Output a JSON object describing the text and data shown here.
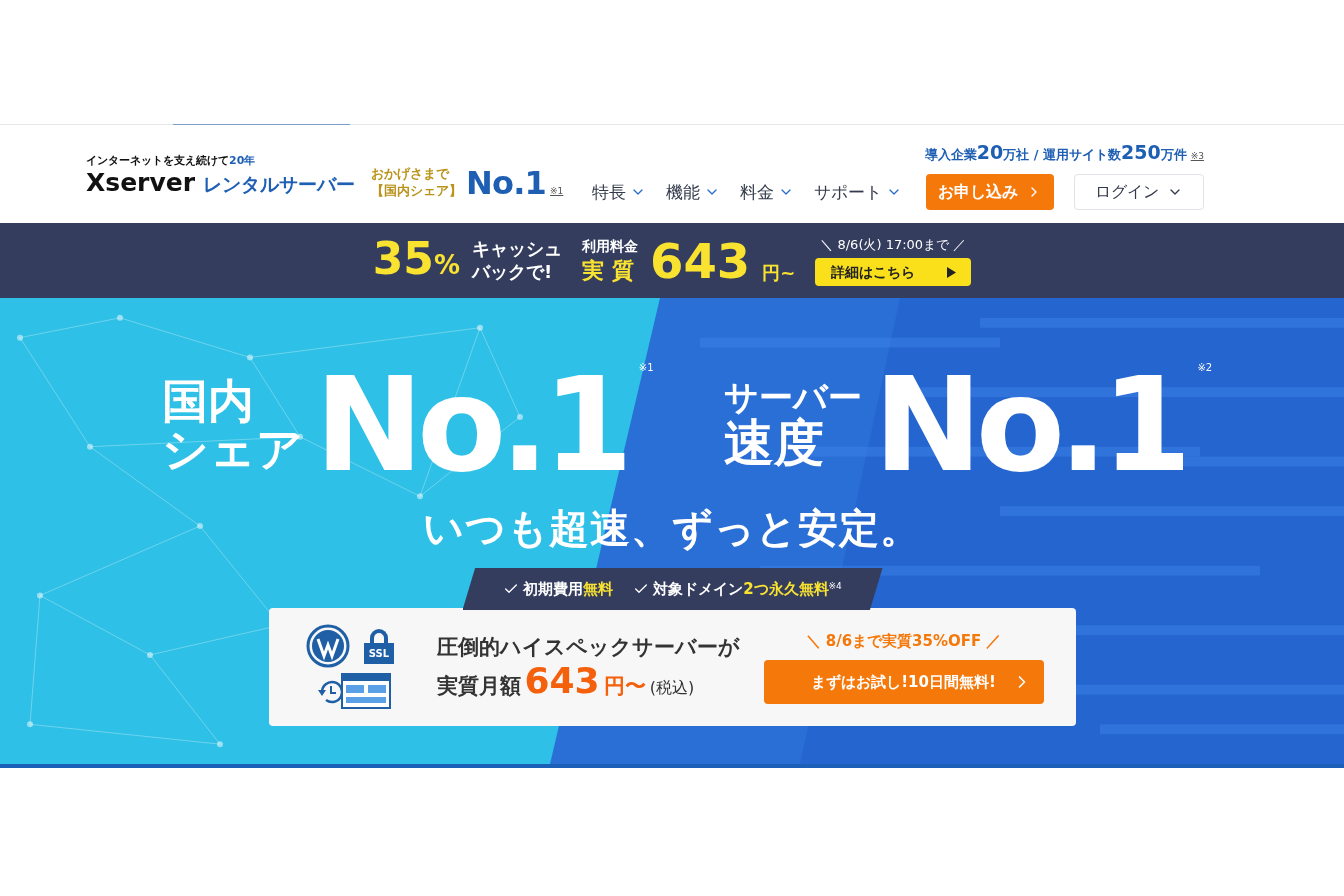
{
  "header": {
    "tagline": "インターネットを支え続けて",
    "tagline_years": "20年",
    "logo_word": "Xserver",
    "logo_sub": "レンタルサーバー",
    "award_line1": "おかげさまで",
    "award_line2": "【国内シェア】",
    "award_no": "No.1",
    "award_note": "※1",
    "stats": "導入企業**20**万社 / 運用サイト数**250**万件",
    "stats_note": "※3",
    "nav": [
      {
        "label": "特長",
        "kind": "dropdown"
      },
      {
        "label": "機能",
        "kind": "dropdown"
      },
      {
        "label": "料金",
        "kind": "dropdown"
      },
      {
        "label": "サポート",
        "kind": "dropdown"
      }
    ],
    "apply_button": "お申し込み",
    "login_button": "ログイン"
  },
  "campaign": {
    "percent": "35",
    "percent_sign": "%",
    "cashback_lines": [
      "キャッシュ",
      "バックで!"
    ],
    "fee_label": "利用料金",
    "fee_prefix": "実 質",
    "price": "643",
    "price_unit": "円~",
    "deadline": "＼ 8/6(火) 17:00まで ／",
    "details_button": "詳細はこちら"
  },
  "hero": {
    "left_lines": [
      "国内",
      "シェア"
    ],
    "left_big": "No.1",
    "left_note": "※1",
    "right_lines": [
      "サーバー",
      "速度"
    ],
    "right_big": "No.1",
    "right_note": "※2",
    "tagline": "いつも超速、ずっと安定。",
    "ribbon": [
      "初期費用**無料**",
      "対象ドメイン**2つ永久無料**$^{※4}$"
    ],
    "ssl_label": "SSL",
    "card_line1": "圧倒的ハイスペックサーバーが",
    "card_line2_prefix": "実質月額",
    "card_price": "643",
    "card_unit": "円〜",
    "card_tax": "(税込)",
    "offer": "＼ 8/6まで実質35%OFF ／",
    "trial_button": "まずはお試し!10日間無料!"
  }
}
